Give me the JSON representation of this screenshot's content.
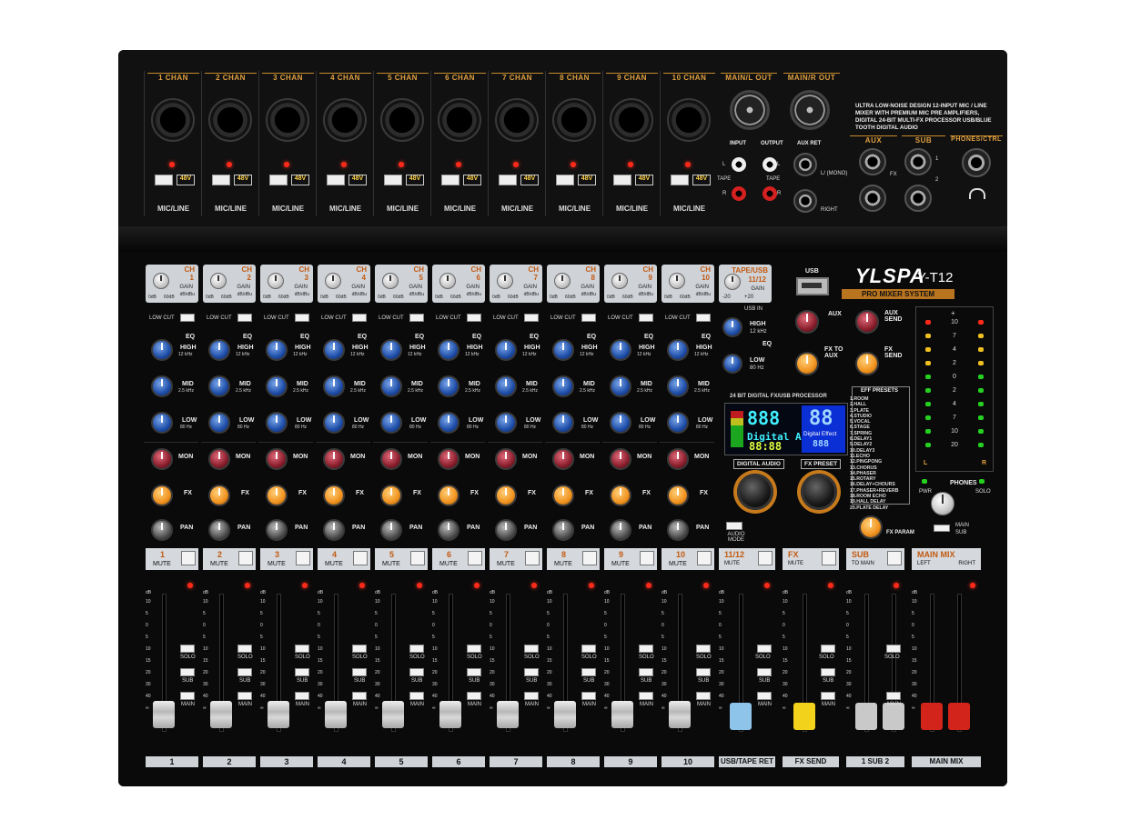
{
  "brand": {
    "logo": "YLSPA",
    "model": "Y-T12",
    "subtitle": "PRO MIXER SYSTEM"
  },
  "description": "ULTRA LOW-NOISE DESIGN 12-INPUT MIC / LINE MIXER WITH PREMIUM MIC PRE AMPLIFIERS, DIGITAL 24-BIT MULTI-FX PROCESSOR USB/BLUE TOOTH DIGITAL AUDIO",
  "inputs": {
    "channels": [
      "1 CHAN",
      "2 CHAN",
      "3 CHAN",
      "4 CHAN",
      "5 CHAN",
      "6 CHAN",
      "7 CHAN",
      "8 CHAN",
      "9 CHAN",
      "10 CHAN"
    ],
    "phantom_label": "48V",
    "jack_label": "MIC/LINE",
    "main_l": "MAIN/L OUT",
    "main_r": "MAIN/R OUT",
    "input": "INPUT",
    "output": "OUTPUT",
    "tape": "TAPE",
    "l": "L",
    "r": "R",
    "aux_ret": "AUX RET",
    "aux_ret_mono": "L/ (MONO)",
    "aux_ret_right": "RIGHT",
    "aux": "AUX",
    "sub": "SUB",
    "phones_ctrl": "PHONES/CTRL",
    "fx": "FX",
    "one": "1",
    "two": "2"
  },
  "strip": {
    "ch": "CH",
    "numbers": [
      "1",
      "2",
      "3",
      "4",
      "5",
      "6",
      "7",
      "8",
      "9",
      "10"
    ],
    "gain": "GAIN",
    "gain_unit": "dB/dBu",
    "gain_min": "0dB",
    "gain_max": "60dB",
    "low_cut": "LOW CUT",
    "eq": "EQ",
    "high": "HIGH",
    "high_f": "12 kHz",
    "mid": "MID",
    "mid_f": "2.5 kHz",
    "low": "LOW",
    "low_f": "80 Hz",
    "mon": "MON",
    "fx": "FX",
    "pan": "PAN",
    "mute": "MUTE",
    "solo": "SOLO",
    "sub": "SUB",
    "main": "MAIN",
    "db": "dB",
    "scale": [
      "10",
      "5",
      "0",
      "5",
      "10",
      "15",
      "20",
      "30",
      "40",
      "∞"
    ]
  },
  "tape": {
    "title": "TAPE/USB",
    "ch": "11/12",
    "gain": "GAIN",
    "gain_unit": "dB/dBu",
    "min": "-20",
    "max": "+20",
    "usb_in": "USB IN",
    "high": "HIGH",
    "high_f": "12 kHz",
    "low": "LOW",
    "low_f": "80 Hz",
    "eq": "EQ"
  },
  "usb": "USB",
  "master_knobs": {
    "aux": "AUX",
    "aux_send": "AUX SEND",
    "fx_to_aux": "FX TO AUX",
    "fx_send": "FX SEND",
    "fx_param": "FX PARAM"
  },
  "fx_processor": {
    "title": "24 BIT DIGITAL FX/USB PROCESSOR",
    "left_digits": "888",
    "left_time": "88:88",
    "left_caption": "Digital Audio",
    "right_digits": "88",
    "right_caption": "Digital Effect",
    "right_small": "888",
    "digital_audio": "DIGITAL AUDIO",
    "fx_preset": "FX PRESET",
    "audio_mode": "AUDIO MODE"
  },
  "eff_presets": {
    "title": "EFF PRESETS",
    "items": [
      "1.ROOM",
      "2.HALL",
      "3.PLATE",
      "4.STUDIO",
      "5.VOCAL",
      "6.STAGE",
      "7.SPRING",
      "8.DELAY1",
      "9.DELAY2",
      "10.DELAY3",
      "11.ECHO",
      "12.PINGPONG",
      "13.CHORUS",
      "14.PHASER",
      "15.ROTARY",
      "16.DELAY+CHOURS",
      "17.PHASER+REVERB",
      "18.ROOM ECHO",
      "19.HALL DELAY",
      "20.PLATE DELAY"
    ]
  },
  "meter": {
    "clip": "+",
    "labels": [
      "10",
      "7",
      "4",
      "2",
      "0",
      "2",
      "4",
      "7",
      "10",
      "20"
    ],
    "l": "L",
    "r": "R",
    "pwr": "PWR",
    "solo": "SOLO"
  },
  "phones": {
    "title": "PHONES",
    "main": "MAIN",
    "sub": "SUB"
  },
  "bus": {
    "tape_num": "11/12",
    "fx": "FX",
    "sub": "SUB",
    "to_main": "TO MAIN",
    "main_mix": "MAIN MIX",
    "left": "LEFT",
    "right": "RIGHT"
  },
  "bottom_labels": [
    "1",
    "2",
    "3",
    "4",
    "5",
    "6",
    "7",
    "8",
    "9",
    "10",
    "USB/TAPE RET",
    "FX SEND",
    "1  SUB  2",
    "MAIN MIX"
  ],
  "colors": {
    "accent_orange": "#e0a040",
    "fader_blue": "#8fc4ea",
    "fader_yellow": "#f2d21a",
    "fader_red": "#d2241b",
    "fader_grey": "#c9c9c9"
  }
}
